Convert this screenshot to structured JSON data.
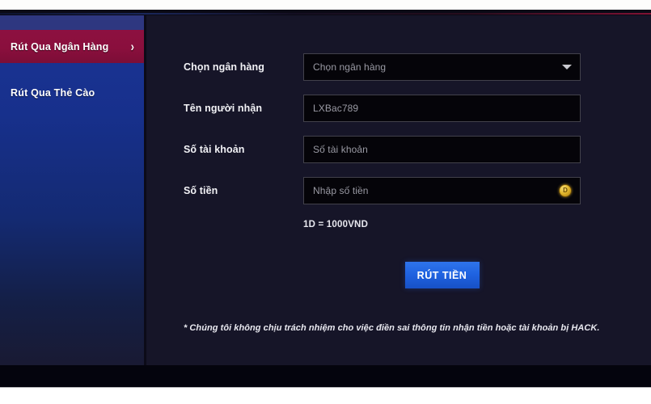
{
  "sidebar": {
    "items": [
      {
        "label": "Rút Qua Ngân Hàng",
        "active": true,
        "chevron": "›"
      },
      {
        "label": "Rút Qua Thẻ Cào",
        "active": false
      }
    ]
  },
  "form": {
    "rows": [
      {
        "label": "Chọn ngân hàng",
        "placeholder": "Chọn ngân hàng",
        "value": "",
        "control": "select"
      },
      {
        "label": "Tên người nhận",
        "placeholder": "LXBac789",
        "value": "",
        "control": "text"
      },
      {
        "label": "Số tài khoản",
        "placeholder": "Số tài khoản",
        "value": "",
        "control": "text"
      },
      {
        "label": "Số tiền",
        "placeholder": "Nhập số tiền",
        "value": "",
        "control": "text-with-coin"
      }
    ],
    "rate_note": "1D = 1000VND",
    "submit_label": "RÚT TIỀN",
    "coin_symbol": "D",
    "disclaimer": "* Chúng tôi không chịu trách nhiệm cho việc điền sai thông tin nhận tiền hoặc tài khoản bị HACK."
  },
  "colors": {
    "sidebar_active": "#8d1040",
    "sidebar_blue": "#17308c",
    "panel_bg": "#161528",
    "input_bg": "#050409",
    "submit_blue": "#1f62e0",
    "coin_gold": "#e3b72c"
  }
}
